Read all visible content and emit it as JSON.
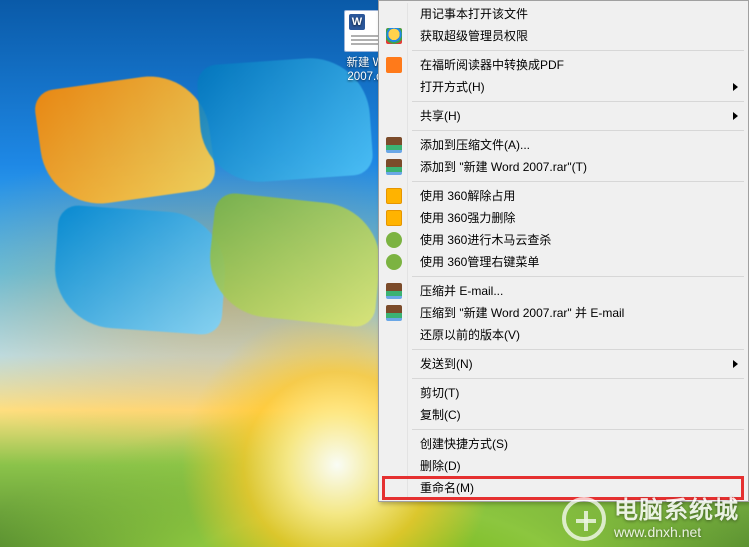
{
  "desktop": {
    "file": {
      "name_line1": "新建 W",
      "name_line2": "2007.d"
    }
  },
  "menu": {
    "items": [
      {
        "id": "notepad-open",
        "label": "用记事本打开该文件",
        "icon": null,
        "submenu": false
      },
      {
        "id": "admin-perm",
        "label": "获取超级管理员权限",
        "icon": "shield",
        "submenu": false
      },
      {
        "sep": true
      },
      {
        "id": "foxit-pdf",
        "label": "在福昕阅读器中转换成PDF",
        "icon": "foxit",
        "submenu": false
      },
      {
        "id": "open-with",
        "label": "打开方式(H)",
        "icon": null,
        "submenu": true
      },
      {
        "sep": true
      },
      {
        "id": "share",
        "label": "共享(H)",
        "icon": null,
        "submenu": true
      },
      {
        "sep": true
      },
      {
        "id": "add-archive",
        "label": "添加到压缩文件(A)...",
        "icon": "rar",
        "submenu": false
      },
      {
        "id": "add-rar",
        "label": "添加到 \"新建 Word 2007.rar\"(T)",
        "icon": "rar",
        "submenu": false
      },
      {
        "sep": true
      },
      {
        "id": "360-unlock",
        "label": "使用 360解除占用",
        "icon": "360y1",
        "submenu": false
      },
      {
        "id": "360-force-del",
        "label": "使用 360强力删除",
        "icon": "360y2",
        "submenu": false
      },
      {
        "id": "360-trojan",
        "label": "使用 360进行木马云查杀",
        "icon": "360g1",
        "submenu": false
      },
      {
        "id": "360-ctxmenu",
        "label": "使用 360管理右键菜单",
        "icon": "360g2",
        "submenu": false
      },
      {
        "sep": true
      },
      {
        "id": "zip-email",
        "label": "压缩并 E-mail...",
        "icon": "rar",
        "submenu": false
      },
      {
        "id": "zip-rar-email",
        "label": "压缩到 \"新建 Word 2007.rar\" 并 E-mail",
        "icon": "rar",
        "submenu": false
      },
      {
        "id": "prev-versions",
        "label": "还原以前的版本(V)",
        "icon": null,
        "submenu": false
      },
      {
        "sep": true
      },
      {
        "id": "send-to",
        "label": "发送到(N)",
        "icon": null,
        "submenu": true
      },
      {
        "sep": true
      },
      {
        "id": "cut",
        "label": "剪切(T)",
        "icon": null,
        "submenu": false
      },
      {
        "id": "copy",
        "label": "复制(C)",
        "icon": null,
        "submenu": false
      },
      {
        "sep": true
      },
      {
        "id": "create-shortcut",
        "label": "创建快捷方式(S)",
        "icon": null,
        "submenu": false
      },
      {
        "id": "delete",
        "label": "删除(D)",
        "icon": null,
        "submenu": false
      },
      {
        "id": "rename",
        "label": "重命名(M)",
        "icon": null,
        "submenu": false,
        "highlighted": true
      }
    ]
  },
  "watermark": {
    "title": "电脑系统城",
    "url": "www.dnxh.net"
  }
}
